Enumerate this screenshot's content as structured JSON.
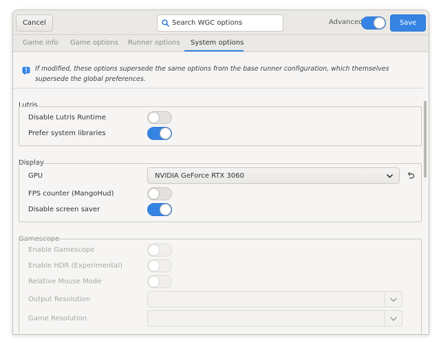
{
  "header": {
    "cancel_label": "Cancel",
    "search_placeholder": "Search WGC options",
    "advanced_label": "Advanced",
    "advanced_on": true,
    "save_label": "Save"
  },
  "tabs": [
    {
      "label": "Game info",
      "active": false
    },
    {
      "label": "Game options",
      "active": false
    },
    {
      "label": "Runner options",
      "active": false
    },
    {
      "label": "System options",
      "active": true
    }
  ],
  "info_text": "If modified, these options supersede the same options from the base runner configuration, which themselves supersede the global preferences.",
  "sections": {
    "lutris": {
      "title": "Lutris",
      "options": [
        {
          "label": "Disable Lutris Runtime",
          "value": false
        },
        {
          "label": "Prefer system libraries",
          "value": true
        }
      ]
    },
    "display": {
      "title": "Display",
      "gpu_label": "GPU",
      "gpu_value": "NVIDIA GeForce RTX 3060",
      "options": [
        {
          "label": "FPS counter (MangoHud)",
          "value": false
        },
        {
          "label": "Disable screen saver",
          "value": true
        }
      ]
    },
    "gamescope": {
      "title": "Gamescope",
      "options": [
        {
          "label": "Enable Gamescope",
          "value": false
        },
        {
          "label": "Enable HDR (Experimental)",
          "value": false
        },
        {
          "label": "Relative Mouse Mode",
          "value": false
        }
      ],
      "output_resolution_label": "Output Resolution",
      "game_resolution_label": "Game Resolution"
    }
  },
  "colors": {
    "accent": "#3584e4",
    "window_bg": "#f6f5f4"
  }
}
